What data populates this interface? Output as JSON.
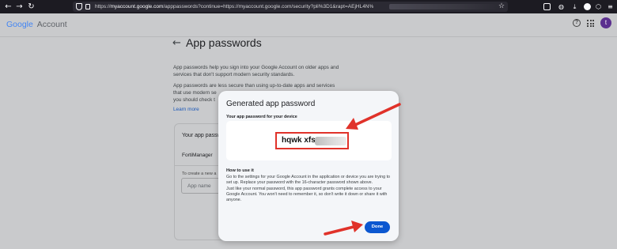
{
  "browser": {
    "url_prefix": "https://",
    "url_domain": "myaccount.google.com",
    "url_rest": "/apppasswords?continue=https://myaccount.google.com/security?pli%3D1&rapt=AEjHL4N%"
  },
  "header": {
    "logo_text": "Google",
    "account_label": "Account",
    "avatar_initial": "t"
  },
  "page": {
    "title": "App passwords",
    "para1": "App passwords help you sign into your Google Account on older apps and services that don't support modern security standards.",
    "para2_line1": "App passwords are less secure than using up-to-date apps and services",
    "para2_line2": "that use modern se",
    "para2_line3": "you should check t",
    "learn_more": "Learn more",
    "card_title": "Your app passw",
    "card_item": "FortiManager",
    "card_create": "To create a new a",
    "app_name_placeholder": "App name"
  },
  "dialog": {
    "title": "Generated app password",
    "password_label": "Your app password for your device",
    "password_visible": "hqwk xfsz",
    "how_title": "How to use it",
    "how_text1": "Go to the settings for your Google Account in the application or device you are trying to set up. Replace your password with the 16-character password shown above.",
    "how_text2": "Just like your normal password, this app password grants complete access to your Google Account. You won't need to remember it, so don't write it down or share it with anyone.",
    "done_label": "Done"
  },
  "colors": {
    "accent": "#0b57d0",
    "annotation": "#e0322a",
    "overlay": "#c9cacc",
    "dialog_bg": "#f4f6f9"
  }
}
